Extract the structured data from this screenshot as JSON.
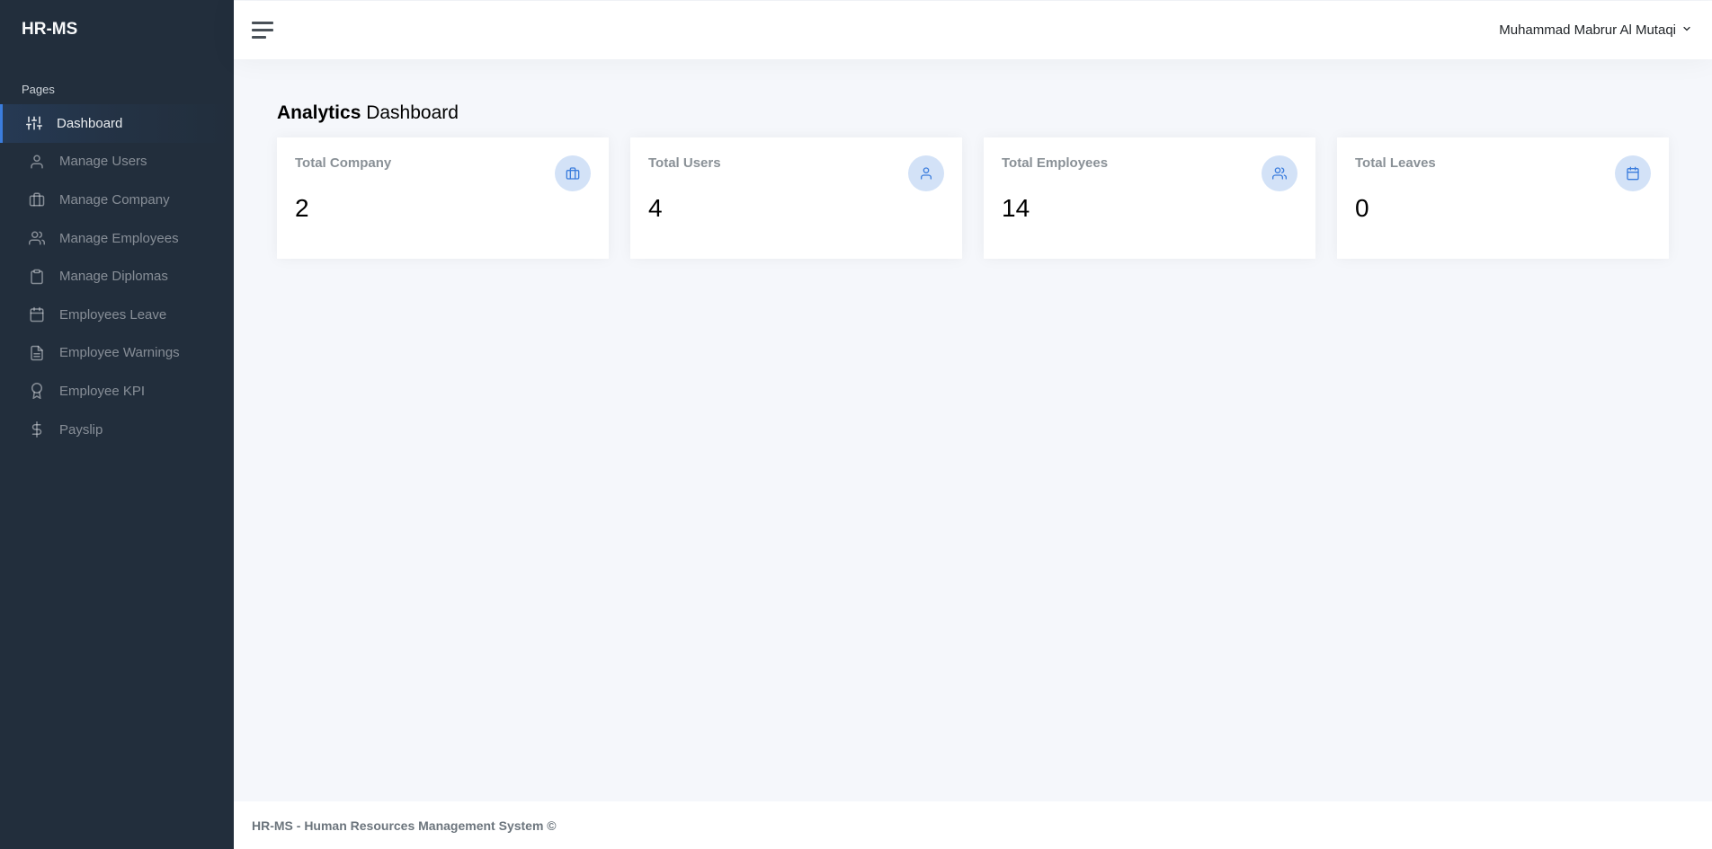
{
  "brand": "HR-MS",
  "sidebar": {
    "header": "Pages",
    "items": [
      {
        "label": "Dashboard",
        "icon": "sliders-icon"
      },
      {
        "label": "Manage Users",
        "icon": "user-icon"
      },
      {
        "label": "Manage Company",
        "icon": "briefcase-icon"
      },
      {
        "label": "Manage Employees",
        "icon": "users-icon"
      },
      {
        "label": "Manage Diplomas",
        "icon": "clipboard-icon"
      },
      {
        "label": "Employees Leave",
        "icon": "calendar-icon"
      },
      {
        "label": "Employee Warnings",
        "icon": "file-text-icon"
      },
      {
        "label": "Employee KPI",
        "icon": "award-icon"
      },
      {
        "label": "Payslip",
        "icon": "dollar-sign-icon"
      }
    ]
  },
  "topbar": {
    "user_name": "Muhammad Mabrur Al Mutaqi"
  },
  "main": {
    "title_bold": "Analytics",
    "title_rest": " Dashboard",
    "cards": [
      {
        "title": "Total Company",
        "value": "2",
        "icon": "briefcase-icon"
      },
      {
        "title": "Total Users",
        "value": "4",
        "icon": "user-icon"
      },
      {
        "title": "Total Employees",
        "value": "14",
        "icon": "users-icon"
      },
      {
        "title": "Total Leaves",
        "value": "0",
        "icon": "calendar-icon"
      }
    ]
  },
  "footer": {
    "text": "HR-MS - Human Resources Management System ©"
  },
  "colors": {
    "sidebar_bg": "#222e3c",
    "accent": "#3b7ddd",
    "page_bg": "#f5f7fb",
    "stat_bg": "#d3e2f7"
  }
}
